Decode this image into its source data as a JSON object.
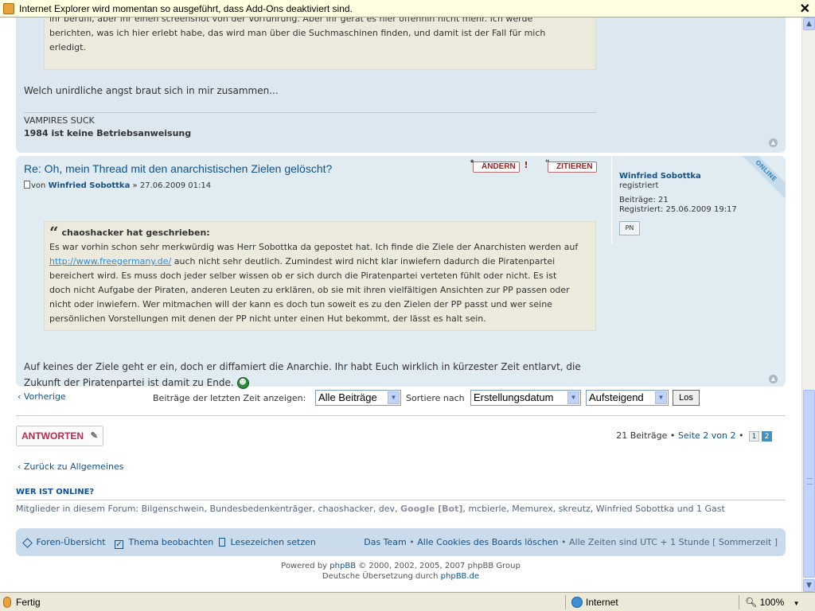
{
  "infobar": {
    "message": "Internet Explorer wird momentan so ausgeführt, dass Add-Ons deaktiviert sind.",
    "close": "✕"
  },
  "post1": {
    "quote_lines": [
      "ihr berufli, aber ihr einen screenshot von der Vorführung. Aber ihr gerät es hier offenhin nicht mehr. Ich werde",
      "berichten, was ich hier erlebt habe, das wird man über die Suchmaschinen finden, und damit ist der Fall für mich",
      "erledigt."
    ],
    "text": "Welch unirdliche angst braut sich in mir zusammen...",
    "sig_line1": "VAMPIRES SUCK",
    "sig_line2": "1984 ist keine Betriebsanweisung"
  },
  "post2": {
    "title": "Re: Oh, mein Thread mit den anarchistischen Zielen gelöscht?",
    "meta_prefix": "von",
    "author": "Winfried Sobottka",
    "date": "» 27.06.2009 01:14",
    "edit_label": "ÄNDERN",
    "quote_label": "ZITIEREN",
    "report_label": "!",
    "quote_head": "chaoshacker hat geschrieben:",
    "quote_line1": "Es war vorhin schon sehr merkwürdig was Herr Sobottka da gepostet hat. Ich finde die Ziele der Anarchisten werden auf",
    "quote_link": "http://www.freegermany.de/",
    "quote_line2_rest": " auch nicht sehr deutlich. Zumindest wird nicht klar inwiefern dadurch die Piratenpartei",
    "quote_line3": "bereichert wird. Es muss doch jeder selber wissen ob er sich durch die Piratenpartei verteten fühlt oder nicht. Es ist",
    "quote_line4": "doch nicht Aufgabe der Piraten, anderen Leuten zu erklären, ob sie mit ihren vielfältigen Ansichten zur PP passen oder",
    "quote_line5": "nicht oder inwiefern. Wer mitmachen will der kann es doch tun soweit es zu den Zielen der PP passt und wer seine",
    "quote_line6": "persönlichen Vorstellungen mit denen der PP nicht unter einen Hut bekommt, der lässt es halt sein.",
    "text_line1": "Auf keines der Ziele geht er ein, doch er diffamiert die Anarchie. Ihr habt Euch wirklich in kürzester Zeit entlarvt, die",
    "text_line2": "Zukunft der Piratenpartei ist damit zu Ende.",
    "profile": {
      "name": "Winfried Sobottka",
      "rank": "registriert",
      "posts": "Beiträge: 21",
      "registered": "Registriert: 25.06.2009 19:17",
      "pm": "PN",
      "online": "ONLINE"
    }
  },
  "actionbar": {
    "prev": "Vorherige",
    "show_label": "Beiträge der letzten Zeit anzeigen:",
    "show_value": "Alle Beiträge",
    "sort_label": "Sortiere nach",
    "sort_value": "Erstellungsdatum",
    "order_value": "Aufsteigend",
    "go": "Los"
  },
  "reply": {
    "label": "ANTWORTEN"
  },
  "pagination": {
    "summary": "21 Beiträge •",
    "page_text": "Seite 2 von 2",
    "bullet": "•",
    "pages": [
      "1",
      "2"
    ]
  },
  "back_link": "Zurück zu Allgemeines",
  "whois": {
    "title": "WER IST ONLINE?",
    "prefix": "Mitglieder in diesem Forum: Bilgenschwein, Bundesbedenkenträger, chaoshacker, dev,",
    "bot": "Google [Bot]",
    "suffix": ", mcbierle, Memurex, skreutz, Winfried Sobottka und 1 Gast"
  },
  "navbar": {
    "index": "Foren-Übersicht",
    "watch": "Thema beobachten",
    "bookmark": "Lesezeichen setzen",
    "team": "Das Team",
    "delete_cookies": "Alle Cookies des Boards löschen",
    "timezone": "Alle Zeiten sind UTC + 1 Stunde [ Sommerzeit ]",
    "bullet": "•"
  },
  "footer": {
    "powered": "Powered by",
    "phpbb": "phpBB",
    "copyright": "© 2000, 2002, 2005, 2007 phpBB Group",
    "translation": "Deutsche Übersetzung durch",
    "translation_link": "phpBB.de"
  },
  "statusbar": {
    "status": "Fertig",
    "zone": "Internet",
    "zoom": "100%"
  },
  "colors": {
    "post_bg": "#dde7ef",
    "link": "#105289",
    "reply": "#bc2a4d",
    "navbar": "#cadceb"
  },
  "icons": [
    "shield-icon",
    "close-icon",
    "top-icon",
    "pm-icon",
    "smiley-icon",
    "pen-icon",
    "home-icon",
    "checkbox-icon",
    "bookmark-icon",
    "globe-icon",
    "zoom-icon"
  ]
}
